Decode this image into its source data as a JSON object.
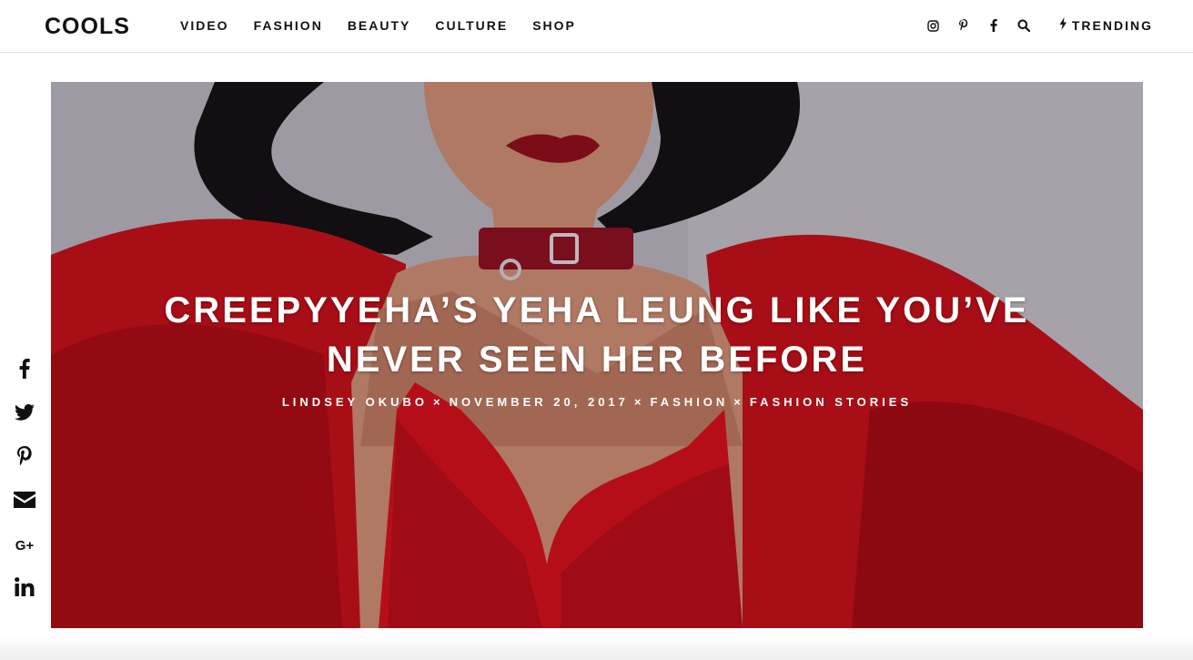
{
  "site": {
    "logo": "COOLS"
  },
  "nav": {
    "items": [
      "VIDEO",
      "FASHION",
      "BEAUTY",
      "CULTURE",
      "SHOP"
    ]
  },
  "header_icons": [
    "instagram-icon",
    "pinterest-icon",
    "facebook-icon",
    "search-icon"
  ],
  "trending": {
    "label": "TRENDING",
    "icon": "lightning-bolt-icon"
  },
  "article": {
    "title_line1": "CREEPYYEHA’S YEHA LEUNG LIKE YOU’VE",
    "title_line2": "NEVER SEEN HER BEFORE",
    "author": "LINDSEY OKUBO",
    "date": "NOVEMBER 20, 2017",
    "category": "FASHION",
    "subcategory": "FASHION STORIES",
    "separator": "×"
  },
  "share_icons": [
    "facebook-icon",
    "twitter-icon",
    "pinterest-icon",
    "email-icon",
    "google-plus-icon",
    "linkedin-icon"
  ],
  "share": {
    "gplus_label": "G+"
  },
  "colors": {
    "text": "#111111",
    "hero_red": "#c8101c",
    "hero_wall": "#b7b3bb",
    "hair": "#141214",
    "white": "#ffffff"
  }
}
